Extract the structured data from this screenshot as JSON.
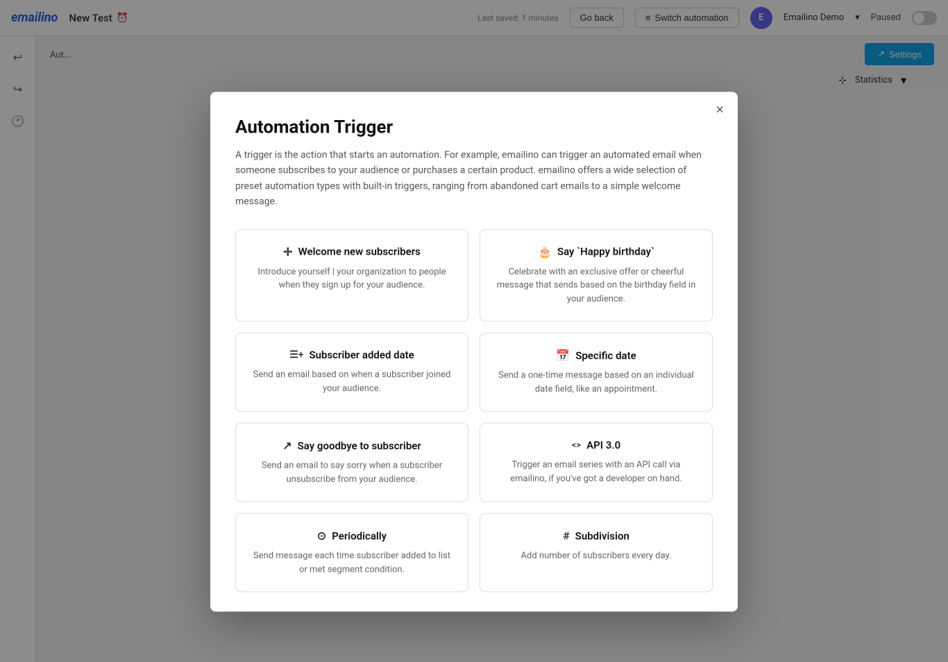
{
  "app": {
    "logo": "emailino",
    "title": "New Test",
    "last_saved": "Last saved: 1 minutes",
    "go_back_label": "Go back",
    "switch_automation_label": "Switch automation",
    "user_name": "Emailino Demo",
    "paused_label": "Paused",
    "settings_label": "Settings",
    "statistics_label": "Statistics"
  },
  "sidebar": {
    "icons": [
      {
        "name": "undo-icon",
        "symbol": "↩"
      },
      {
        "name": "redo-icon",
        "symbol": "↪"
      },
      {
        "name": "history-icon",
        "symbol": "🕐"
      }
    ]
  },
  "breadcrumb": {
    "text": "Aut..."
  },
  "modal": {
    "close_label": "×",
    "title": "Automation Trigger",
    "description": "A trigger is the action that starts an automation. For example, emailino can trigger an automated email when someone subscribes to your audience or purchases a certain product. emailino offers a wide selection of preset automation types with built-in triggers, ranging from abandoned cart emails to a simple welcome message.",
    "triggers": [
      {
        "id": "welcome",
        "icon": "person-add-icon",
        "icon_symbol": "✛",
        "title": "Welcome new subscribers",
        "description": "Introduce yourself | your organization to people when they sign up for your audience."
      },
      {
        "id": "birthday",
        "icon": "birthday-icon",
        "icon_symbol": "🎂",
        "title": "Say `Happy birthday`",
        "description": "Celebrate with an exclusive offer or cheerful message that sends based on the birthday field in your audience."
      },
      {
        "id": "subscriber-date",
        "icon": "calendar-add-icon",
        "icon_symbol": "☰+",
        "title": "Subscriber added date",
        "description": "Send an email based on when a subscriber joined your audience."
      },
      {
        "id": "specific-date",
        "icon": "calendar-icon",
        "icon_symbol": "📅",
        "title": "Specific date",
        "description": "Send a one-time message based on an individual date field, like an appointment."
      },
      {
        "id": "goodbye",
        "icon": "goodbye-icon",
        "icon_symbol": "↗",
        "title": "Say goodbye to subscriber",
        "description": "Send an email to say sorry when a subscriber unsubscribe from your audience."
      },
      {
        "id": "api",
        "icon": "api-icon",
        "icon_symbol": "<>",
        "title": "API 3.0",
        "description": "Trigger an email series with an API call via emailino, if you've got a developer on hand."
      },
      {
        "id": "periodically",
        "icon": "refresh-icon",
        "icon_symbol": "⟳",
        "title": "Periodically",
        "description": "Send message each time subscriber added to list or met segment condition."
      },
      {
        "id": "subdivision",
        "icon": "hash-icon",
        "icon_symbol": "#",
        "title": "Subdivision",
        "description": "Add number of subscribers every day."
      }
    ]
  }
}
